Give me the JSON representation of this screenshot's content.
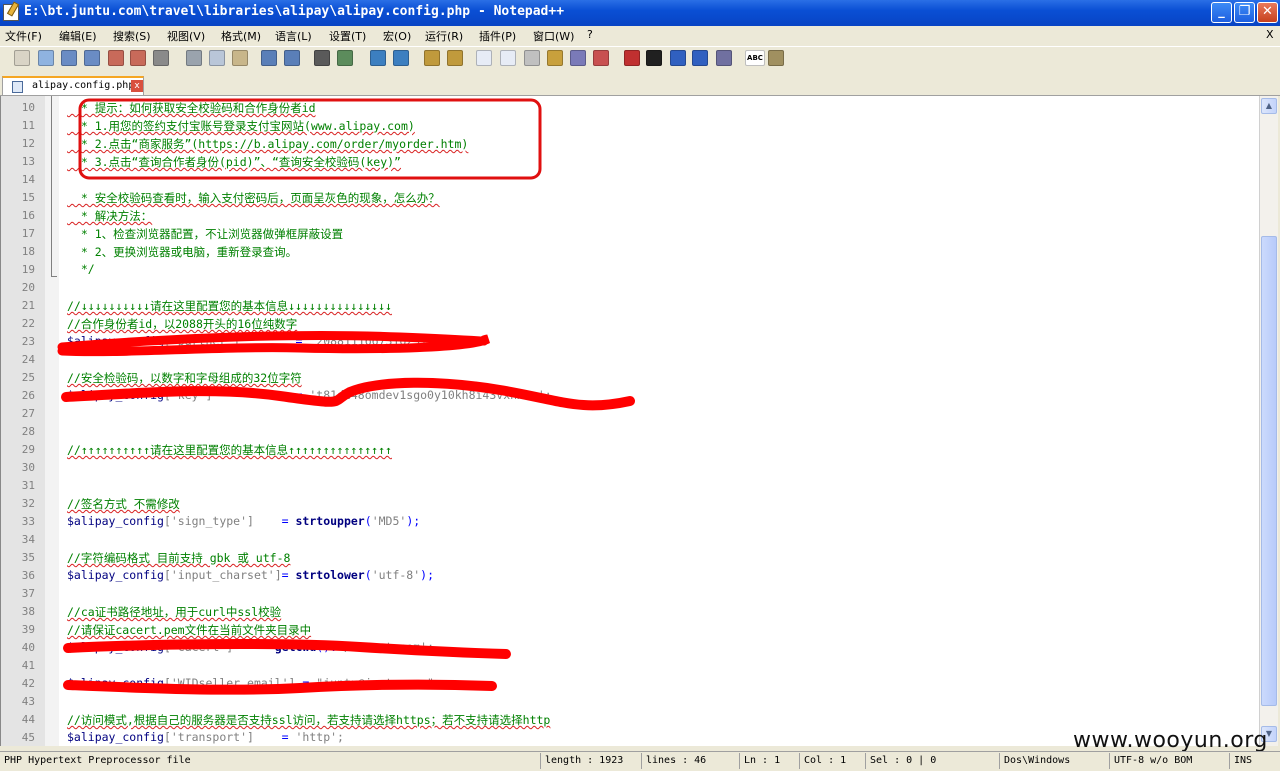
{
  "window": {
    "title": "E:\\bt.juntu.com\\travel\\libraries\\alipay\\alipay.config.php - Notepad++",
    "minimize": "_",
    "maximize": "❐",
    "close": "✕"
  },
  "menu": [
    {
      "label": "文件(F)"
    },
    {
      "label": "编辑(E)"
    },
    {
      "label": "搜索(S)"
    },
    {
      "label": "视图(V)"
    },
    {
      "label": "格式(M)"
    },
    {
      "label": "语言(L)"
    },
    {
      "label": "设置(T)"
    },
    {
      "label": "宏(O)"
    },
    {
      "label": "运行(R)"
    },
    {
      "label": "插件(P)"
    },
    {
      "label": "窗口(W)"
    },
    {
      "label": "?"
    }
  ],
  "menu_close": "X",
  "toolbar_icons": [
    "new-icon",
    "open-icon",
    "save-icon",
    "save-all-icon",
    "close-icon",
    "close-all-icon",
    "print-icon",
    "cut-icon",
    "copy-icon",
    "paste-icon",
    "undo-icon",
    "redo-icon",
    "find-icon",
    "replace-icon",
    "zoom-in-icon",
    "zoom-out-icon",
    "sync-v-icon",
    "sync-h-icon",
    "wrap-icon",
    "show-all-icon",
    "indent-guide-icon",
    "user-lang-icon",
    "doc-map-icon",
    "function-list-icon",
    "record-macro-icon",
    "stop-macro-icon",
    "play-macro-icon",
    "run-macro-icon",
    "save-macro-icon",
    "spellcheck-icon",
    "hex-icon"
  ],
  "toolbar_text": {
    "spellcheck": "ABC"
  },
  "tab": {
    "name": "alipay.config.php",
    "close": "x"
  },
  "lines": [
    {
      "no": "10",
      "segs": [
        {
          "t": "  * 提示：如何获取安全校验码和合作身份者id",
          "c": "c-comment",
          "sq": true
        }
      ]
    },
    {
      "no": "11",
      "segs": [
        {
          "t": "  * 1.用您的签约支付宝账号登录支付宝网站(www.alipay.com)",
          "c": "c-comment",
          "sq": true
        }
      ]
    },
    {
      "no": "12",
      "segs": [
        {
          "t": "  * 2.点击“商家服务”(https://b.alipay.com/order/myorder.htm)",
          "c": "c-comment",
          "sq": true
        }
      ]
    },
    {
      "no": "13",
      "segs": [
        {
          "t": "  * 3.点击“查询合作者身份(pid)”、“查询安全校验码(key)”",
          "c": "c-comment",
          "sq": true
        }
      ]
    },
    {
      "no": "14",
      "segs": []
    },
    {
      "no": "15",
      "segs": [
        {
          "t": "  * 安全校验码查看时，输入支付密码后，页面呈灰色的现象，怎么办？",
          "c": "c-comment",
          "sq": true
        }
      ]
    },
    {
      "no": "16",
      "segs": [
        {
          "t": "  * 解决方法：",
          "c": "c-comment",
          "sq": true
        }
      ]
    },
    {
      "no": "17",
      "segs": [
        {
          "t": "  * 1、检查浏览器配置，不让浏览器做弹框屏蔽设置",
          "c": "c-comment"
        }
      ]
    },
    {
      "no": "18",
      "segs": [
        {
          "t": "  * 2、更换浏览器或电脑，重新登录查询。",
          "c": "c-comment"
        }
      ]
    },
    {
      "no": "19",
      "segs": [
        {
          "t": "  */",
          "c": "c-comment"
        }
      ]
    },
    {
      "no": "20",
      "segs": []
    },
    {
      "no": "21",
      "segs": [
        {
          "t": "//↓↓↓↓↓↓↓↓↓↓请在这里配置您的基本信息↓↓↓↓↓↓↓↓↓↓↓↓↓↓↓",
          "c": "c-comment",
          "sq": true
        }
      ]
    },
    {
      "no": "22",
      "segs": [
        {
          "t": "//合作身份者id，以2088开头的16位纯数字",
          "c": "c-comment",
          "sq": true
        }
      ]
    },
    {
      "no": "23",
      "segs": [
        {
          "t": "$alipay_config",
          "c": "c-var"
        },
        {
          "t": "['partner']",
          "c": "c-str"
        },
        {
          "t": "        = ",
          "c": "c-op"
        },
        {
          "t": "'2088111667316251';",
          "c": "c-str"
        }
      ]
    },
    {
      "no": "24",
      "segs": []
    },
    {
      "no": "25",
      "segs": [
        {
          "t": "//安全检验码，以数字和字母组成的32位字符",
          "c": "c-comment",
          "sq": true
        }
      ]
    },
    {
      "no": "26",
      "segs": [
        {
          "t": "$alipay_config",
          "c": "c-var"
        },
        {
          "t": "['key']",
          "c": "c-str"
        },
        {
          "t": "            = ",
          "c": "c-op"
        },
        {
          "t": "'t81de48omdev1sgo0y10kh8i43vxhx8x';",
          "c": "c-str"
        }
      ]
    },
    {
      "no": "27",
      "segs": []
    },
    {
      "no": "28",
      "segs": []
    },
    {
      "no": "29",
      "segs": [
        {
          "t": "//↑↑↑↑↑↑↑↑↑↑请在这里配置您的基本信息↑↑↑↑↑↑↑↑↑↑↑↑↑↑↑",
          "c": "c-comment",
          "sq": true
        }
      ]
    },
    {
      "no": "30",
      "segs": []
    },
    {
      "no": "31",
      "segs": []
    },
    {
      "no": "32",
      "segs": [
        {
          "t": "//签名方式 不需修改",
          "c": "c-comment",
          "sq": true
        }
      ]
    },
    {
      "no": "33",
      "segs": [
        {
          "t": "$alipay_config",
          "c": "c-var"
        },
        {
          "t": "['sign_type']",
          "c": "c-str"
        },
        {
          "t": "    = ",
          "c": "c-op"
        },
        {
          "t": "strtoupper",
          "c": "c-func"
        },
        {
          "t": "(",
          "c": "c-op"
        },
        {
          "t": "'MD5'",
          "c": "c-str"
        },
        {
          "t": ");",
          "c": "c-op"
        }
      ]
    },
    {
      "no": "34",
      "segs": []
    },
    {
      "no": "35",
      "segs": [
        {
          "t": "//字符编码格式 目前支持 gbk 或 utf-8",
          "c": "c-comment",
          "sq": true
        }
      ]
    },
    {
      "no": "36",
      "segs": [
        {
          "t": "$alipay_config",
          "c": "c-var"
        },
        {
          "t": "['input_charset']",
          "c": "c-str"
        },
        {
          "t": "= ",
          "c": "c-op"
        },
        {
          "t": "strtolower",
          "c": "c-func"
        },
        {
          "t": "(",
          "c": "c-op"
        },
        {
          "t": "'utf-8'",
          "c": "c-str"
        },
        {
          "t": ");",
          "c": "c-op"
        }
      ]
    },
    {
      "no": "37",
      "segs": []
    },
    {
      "no": "38",
      "segs": [
        {
          "t": "//ca证书路径地址，用于curl中ssl校验",
          "c": "c-comment",
          "sq": true
        }
      ]
    },
    {
      "no": "39",
      "segs": [
        {
          "t": "//请保证cacert.pem文件在当前文件夹目录中",
          "c": "c-comment",
          "sq": true
        }
      ]
    },
    {
      "no": "40",
      "segs": [
        {
          "t": "$alipay_config",
          "c": "c-var"
        },
        {
          "t": "['cacert']",
          "c": "c-str"
        },
        {
          "t": "    = ",
          "c": "c-op"
        },
        {
          "t": "getcwd",
          "c": "c-func"
        },
        {
          "t": "().",
          "c": "c-op"
        },
        {
          "t": "'/cacert.pem';",
          "c": "c-str"
        }
      ]
    },
    {
      "no": "41",
      "segs": []
    },
    {
      "no": "42",
      "segs": [
        {
          "t": "$alipay_config",
          "c": "c-var"
        },
        {
          "t": "['WIDseller_email']",
          "c": "c-str"
        },
        {
          "t": " = ",
          "c": "c-op"
        },
        {
          "t": "\"juntu@juntu.com\";",
          "c": "c-str"
        }
      ]
    },
    {
      "no": "43",
      "segs": []
    },
    {
      "no": "44",
      "segs": [
        {
          "t": "//访问模式,根据自己的服务器是否支持ssl访问，若支持请选择https；若不支持请选择http",
          "c": "c-comment",
          "sq": true
        }
      ]
    },
    {
      "no": "45",
      "segs": [
        {
          "t": "$alipay_config",
          "c": "c-var"
        },
        {
          "t": "['transport']",
          "c": "c-str"
        },
        {
          "t": "    = ",
          "c": "c-op"
        },
        {
          "t": "'http';",
          "c": "c-str"
        }
      ]
    }
  ],
  "status": {
    "filetype": "PHP Hypertext Preprocessor file",
    "length": "length : 1923",
    "lines": "lines : 46",
    "ln": "Ln : 1",
    "col": "Col : 1",
    "sel": "Sel : 0 | 0",
    "eol": "Dos\\Windows",
    "encoding": "UTF-8 w/o BOM",
    "ins": "INS"
  },
  "watermark": "www.wooyun.org",
  "colors": {
    "highlight_box": "#e01010",
    "redaction": "#ff0000",
    "comment": "#008000"
  }
}
